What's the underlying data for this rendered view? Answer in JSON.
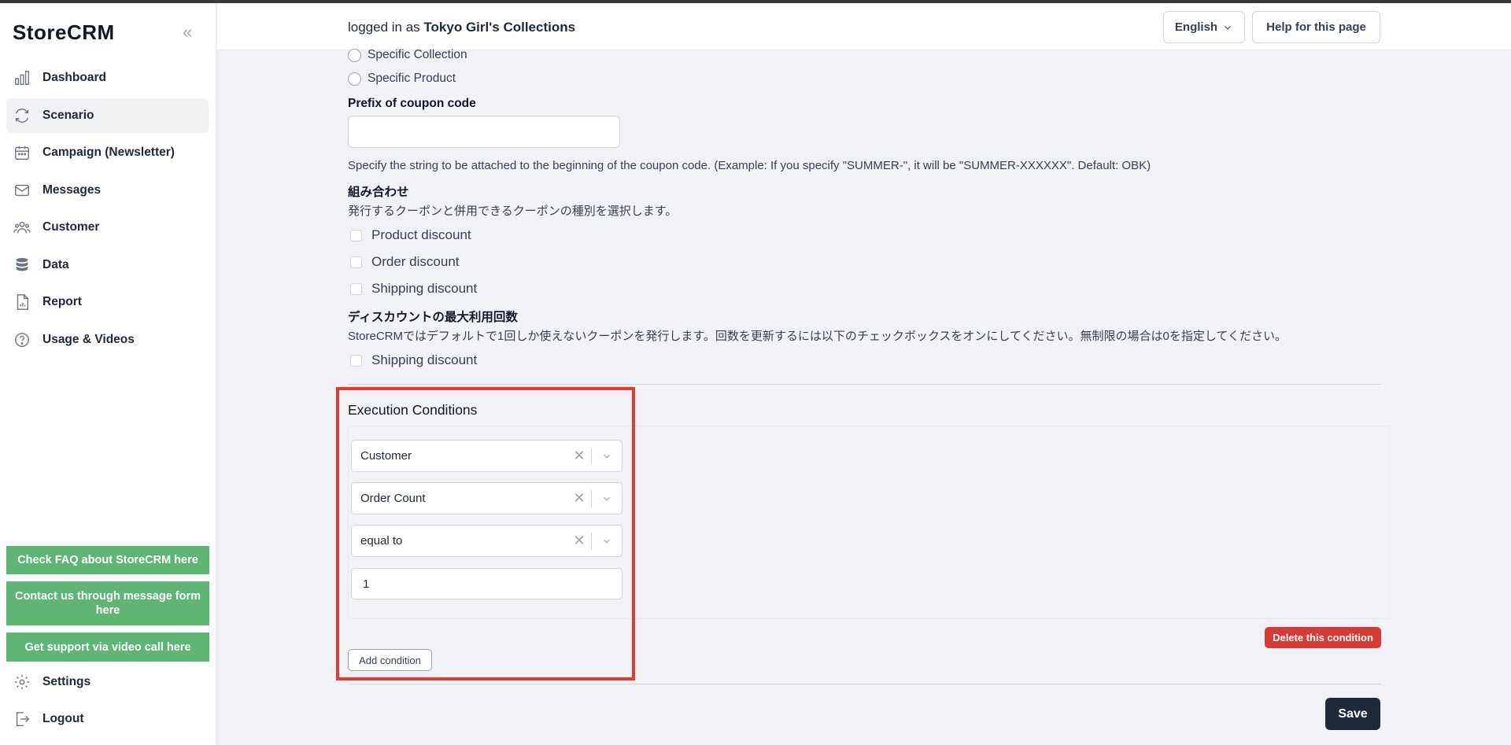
{
  "app": {
    "brand": "StoreCRM"
  },
  "sidebar": {
    "items": [
      {
        "label": "Dashboard",
        "icon": "chart-bars-icon"
      },
      {
        "label": "Scenario",
        "icon": "refresh-icon"
      },
      {
        "label": "Campaign (Newsletter)",
        "icon": "calendar-icon"
      },
      {
        "label": "Messages",
        "icon": "mail-icon"
      },
      {
        "label": "Customer",
        "icon": "users-icon"
      },
      {
        "label": "Data",
        "icon": "database-icon"
      },
      {
        "label": "Report",
        "icon": "document-chart-icon"
      },
      {
        "label": "Usage & Videos",
        "icon": "question-circle-icon"
      }
    ],
    "active_item": "Scenario",
    "support_buttons": {
      "faq": "Check FAQ about StoreCRM here",
      "contact": "Contact us through message form here",
      "video": "Get support via video call here"
    },
    "settings": "Settings",
    "logout": "Logout",
    "support_color": "#5fb574"
  },
  "header": {
    "login_prefix": "logged in as",
    "store_name": "Tokyo Girl's Collections",
    "language": "English",
    "help": "Help for this page"
  },
  "form": {
    "radio_specific_collection": "Specific Collection",
    "radio_specific_product": "Specific Product",
    "prefix_label": "Prefix of coupon code",
    "prefix_value": "",
    "prefix_help": "Specify the string to be attached to the beginning of the coupon code. (Example: If you specify \"SUMMER-\", it will be \"SUMMER-XXXXXX\". Default: OBK)",
    "combination_label": "組み合わせ",
    "combination_help": "発行するクーポンと併用できるクーポンの種別を選択します。",
    "combination_options": [
      "Product discount",
      "Order discount",
      "Shipping discount"
    ],
    "max_usage_label": "ディスカウントの最大利用回数",
    "max_usage_help": "StoreCRMではデフォルトで1回しか使えないクーポンを発行します。回数を更新するには以下のチェックボックスをオンにしてください。無制限の場合は0を指定してください。",
    "max_usage_option": "Shipping discount"
  },
  "execution": {
    "title": "Execution Conditions",
    "condition": {
      "target": "Customer",
      "field": "Order Count",
      "operator": "equal to",
      "value": "1"
    },
    "delete_label": "Delete this condition",
    "add_label": "Add condition",
    "highlight_color": "#e53b2c"
  },
  "actions": {
    "save": "Save"
  }
}
